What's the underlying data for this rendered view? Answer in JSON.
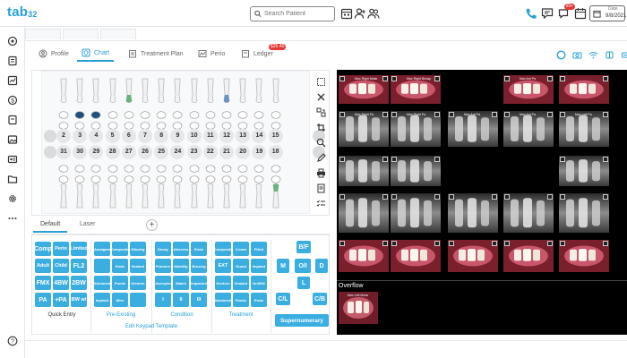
{
  "app": {
    "logo": "tab",
    "logo_num": "32"
  },
  "search": {
    "placeholder": "Search Patient"
  },
  "notifications": {
    "messages_badge": "99+"
  },
  "date": {
    "label": "Date",
    "value": "9/8/2021"
  },
  "patient_tabs": [
    "",
    "",
    ""
  ],
  "module_tabs": [
    {
      "label": "Profile",
      "icon": "user-circle-icon"
    },
    {
      "label": "Chart",
      "icon": "tooth-icon"
    },
    {
      "label": "Treatment Plan",
      "icon": "clipboard-icon"
    },
    {
      "label": "Perio",
      "icon": "perio-icon"
    },
    {
      "label": "Ledger",
      "icon": "ledger-icon",
      "badge": "$26.46"
    }
  ],
  "tooth_numbers_upper": [
    "2",
    "3",
    "4",
    "5",
    "6",
    "7",
    "8",
    "9",
    "10",
    "11",
    "12",
    "13",
    "14",
    "15"
  ],
  "tooth_numbers_lower": [
    "31",
    "30",
    "29",
    "28",
    "27",
    "26",
    "25",
    "24",
    "23",
    "22",
    "21",
    "20",
    "19",
    "18"
  ],
  "keypad": {
    "tabs": [
      "Default",
      "Laser"
    ],
    "add_label": "+",
    "quick_entry": {
      "caption": "Quick Entry",
      "rows": [
        [
          "Comp",
          "Perio",
          "Limited"
        ],
        [
          "Adult",
          "Child",
          "FL2"
        ],
        [
          "FMX",
          "4BW",
          "2BW"
        ],
        [
          "PA",
          "+PA",
          "BW w/"
        ]
      ]
    },
    "pre_existing": {
      "caption": "Pre-Existing",
      "rows": [
        [
          "Amalgam",
          "Composite",
          "Missing"
        ],
        [
          "",
          "Endo",
          "Sealant"
        ],
        [
          "Abutment",
          "Pontic",
          "Denture"
        ],
        [
          "Implant",
          "Wire",
          ""
        ]
      ]
    },
    "condition": {
      "caption": "Condition",
      "rows": [
        [
          "Decay",
          "Abscess",
          "Endo"
        ],
        [
          "Fracture",
          "Mobility",
          "Bruxing"
        ],
        [
          "Unerupted",
          "Watch",
          "Impacted"
        ],
        [
          "I",
          "II",
          "III"
        ]
      ]
    },
    "treatment": {
      "caption": "Treatment",
      "rows": [
        [
          "Composite",
          "Crown",
          "Filled"
        ],
        [
          "EXT",
          "Guard",
          "Implant"
        ],
        [
          "Denture",
          "Sealant",
          "Drill/fill"
        ],
        [
          "Abutment",
          "Pontic",
          "Endo"
        ]
      ]
    },
    "surfaces": [
      "B/F",
      "M",
      "O/I",
      "D",
      "L",
      "C/L",
      "C/B"
    ],
    "supernumerary": "Supernumerary",
    "edit_template": "Edit Keypad Template"
  },
  "xrays": {
    "captions": [
      "Max Right Molar",
      "Max Right Bicusp",
      "Max Ant Pa",
      "Max Right Pa",
      "Max Right Pa",
      "Max Ant Pa",
      "Max Ant Pa",
      "Max Left Pa"
    ],
    "overflow_label": "Overflow",
    "overflow_caption": "Max Left Molar"
  },
  "colors": {
    "accent": "#2a9fd6",
    "keypad_button": "#3aaee0",
    "xray_bg": "#000000"
  }
}
